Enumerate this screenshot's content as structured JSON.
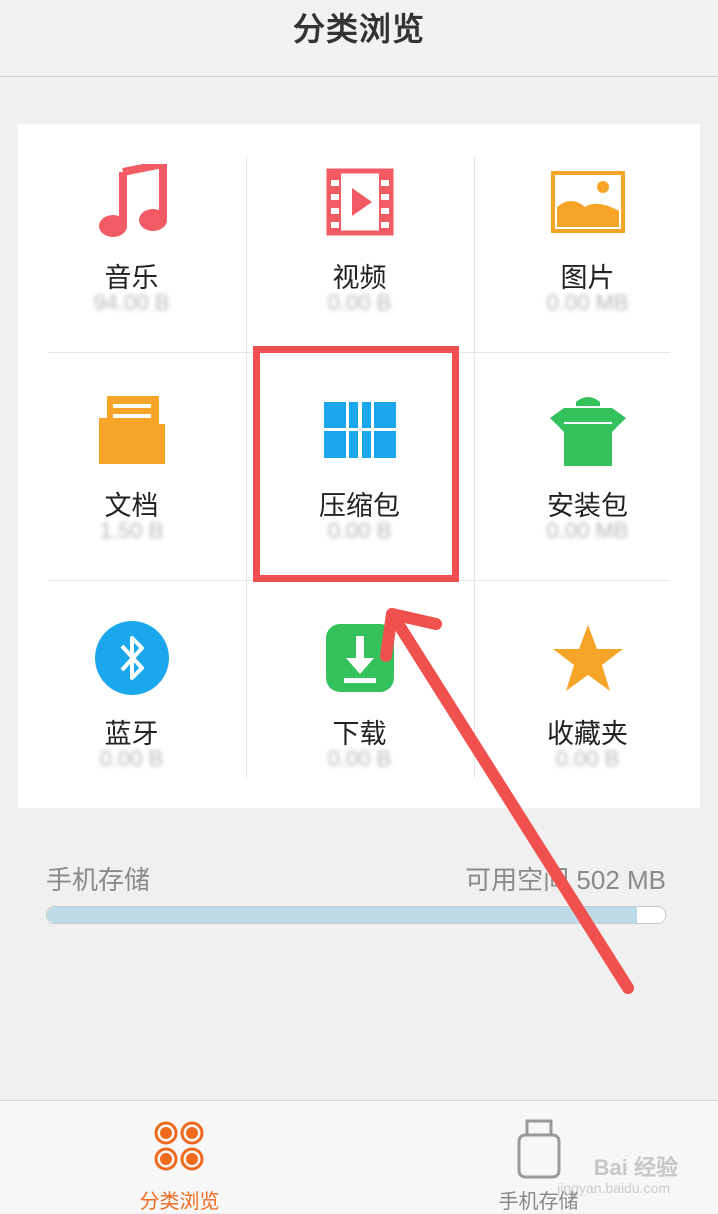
{
  "header": {
    "title": "分类浏览"
  },
  "categories": [
    {
      "label": "音乐",
      "size": "94.00 B",
      "icon": "music-note-icon",
      "color": "#f25b63"
    },
    {
      "label": "视频",
      "size": "0.00 B",
      "icon": "video-film-icon",
      "color": "#f25b63"
    },
    {
      "label": "图片",
      "size": "0.00 MB",
      "icon": "image-icon",
      "color": "#f7a528"
    },
    {
      "label": "文档",
      "size": "1.50 B",
      "icon": "folder-document-icon",
      "color": "#f7a528"
    },
    {
      "label": "压缩包",
      "size": "0.00 B",
      "icon": "archive-icon",
      "color": "#1aa7ec"
    },
    {
      "label": "安装包",
      "size": "0.00 MB",
      "icon": "android-package-icon",
      "color": "#35c15c"
    },
    {
      "label": "蓝牙",
      "size": "0.00 B",
      "icon": "bluetooth-icon",
      "color": "#1aa7ec"
    },
    {
      "label": "下载",
      "size": "0.00 B",
      "icon": "download-icon",
      "color": "#35c15c"
    },
    {
      "label": "收藏夹",
      "size": "0.00 B",
      "icon": "star-icon",
      "color": "#f7a528"
    }
  ],
  "storage": {
    "label": "手机存储",
    "free": "可用空间 502 MB",
    "used_fraction": 0.955
  },
  "bottom_nav": [
    {
      "label": "分类浏览",
      "icon": "grid-dots-icon",
      "active": true,
      "color": "#f06a1e"
    },
    {
      "label": "手机存储",
      "icon": "usb-storage-icon",
      "active": false,
      "color": "#888888"
    }
  ],
  "watermark": {
    "text": "Bai 经验",
    "sub": "jingyan.baidu.com"
  }
}
